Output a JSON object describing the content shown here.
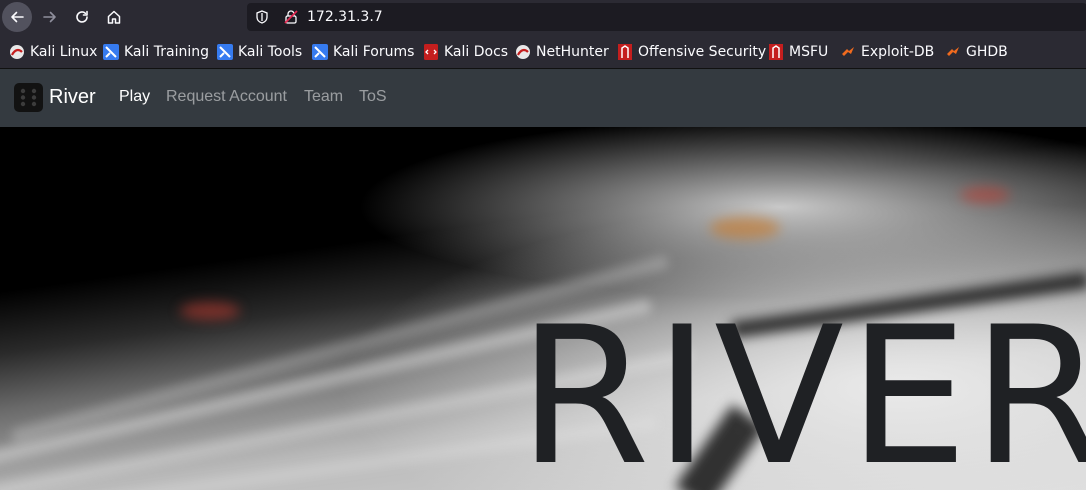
{
  "browser": {
    "url": "172.31.3.7"
  },
  "bookmarks": [
    {
      "label": "Kali Linux",
      "icon": "kali-dragon-icon"
    },
    {
      "label": "Kali Training",
      "icon": "kali-training-icon"
    },
    {
      "label": "Kali Tools",
      "icon": "kali-tools-icon"
    },
    {
      "label": "Kali Forums",
      "icon": "kali-forums-icon"
    },
    {
      "label": "Kali Docs",
      "icon": "kali-docs-icon"
    },
    {
      "label": "NetHunter",
      "icon": "nethunter-icon"
    },
    {
      "label": "Offensive Security",
      "icon": "offsec-icon"
    },
    {
      "label": "MSFU",
      "icon": "msfu-icon"
    },
    {
      "label": "Exploit-DB",
      "icon": "exploitdb-icon"
    },
    {
      "label": "GHDB",
      "icon": "ghdb-icon"
    }
  ],
  "navbar": {
    "brand": "River",
    "links": [
      {
        "label": "Play",
        "active": true
      },
      {
        "label": "Request Account",
        "active": false
      },
      {
        "label": "Team",
        "active": false
      },
      {
        "label": "ToS",
        "active": false
      }
    ]
  },
  "hero": {
    "title": "RIVER"
  },
  "colors": {
    "browser_chrome": "#2b2a33",
    "url_bar": "#1c1b22",
    "navbar": "#343a40",
    "hero_text": "#1f2124"
  }
}
